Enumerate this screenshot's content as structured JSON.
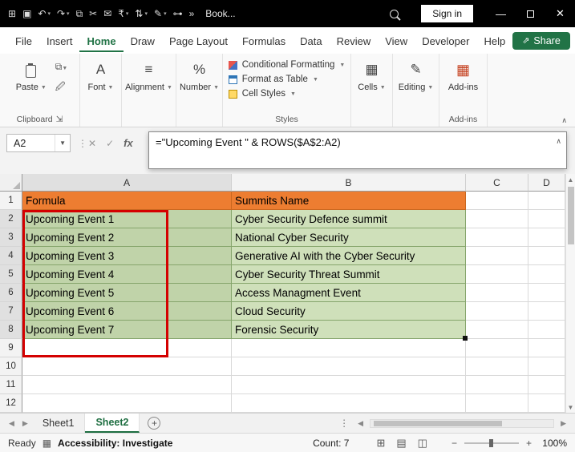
{
  "colors": {
    "excel_green": "#217346",
    "title_bar_bg": "#000000",
    "header_fill_orange": "#ed7d31",
    "cell_fill_green": "#cfe0ba",
    "cell_fill_green_selected": "#c0d3a9",
    "highlight_red": "#d40000",
    "addins_red": "#c43e1c"
  },
  "title_bar": {
    "workbook_name": "Book...",
    "sign_in_label": "Sign in",
    "quick_access": [
      {
        "name": "menu-grid-icon",
        "glyph": "⊞",
        "caret": false
      },
      {
        "name": "save-icon",
        "glyph": "▣",
        "caret": false
      },
      {
        "name": "undo-icon",
        "glyph": "↶",
        "caret": true
      },
      {
        "name": "redo-icon",
        "glyph": "↷",
        "caret": true
      },
      {
        "name": "copy-icon",
        "glyph": "⧉",
        "caret": false
      },
      {
        "name": "cut-icon",
        "glyph": "✂",
        "caret": false
      },
      {
        "name": "mail-icon",
        "glyph": "✉",
        "caret": false
      },
      {
        "name": "currency-icon",
        "glyph": "₹",
        "caret": true
      },
      {
        "name": "sort-icon",
        "glyph": "⇅",
        "caret": true
      },
      {
        "name": "draw-icon",
        "glyph": "✎",
        "caret": true
      },
      {
        "name": "pin-icon",
        "glyph": "⊶",
        "caret": false
      },
      {
        "name": "more-commands-icon",
        "glyph": "»",
        "caret": false
      }
    ]
  },
  "ribbon": {
    "tabs": [
      "File",
      "Insert",
      "Home",
      "Draw",
      "Page Layout",
      "Formulas",
      "Data",
      "Review",
      "View",
      "Developer",
      "Help"
    ],
    "active_tab": "Home",
    "share_label": "Share",
    "paste_label": "Paste",
    "collapsed_groups": [
      {
        "name": "font",
        "label": "Font",
        "icon": "A"
      },
      {
        "name": "alignment",
        "label": "Alignment",
        "icon": "≡"
      },
      {
        "name": "number",
        "label": "Number",
        "icon": "%"
      }
    ],
    "styles_items": [
      "Conditional Formatting",
      "Format as Table",
      "Cell Styles"
    ],
    "styles_group_label": "Styles",
    "clipboard_group_label": "Clipboard",
    "right_groups": [
      {
        "name": "cells",
        "label": "Cells",
        "icon": "▦"
      },
      {
        "name": "editing",
        "label": "Editing",
        "icon": "✎"
      }
    ],
    "addins_label": "Add-ins",
    "addins_group_label": "Add-ins"
  },
  "formula_bar": {
    "name_box": "A2",
    "formula": "=\"Upcoming Event \" & ROWS($A$2:A2)"
  },
  "grid": {
    "column_headers": [
      "A",
      "B",
      "C",
      "D"
    ],
    "row_count": 12,
    "selected_column": "A",
    "selected_rows": [
      2,
      3,
      4,
      5,
      6,
      7,
      8
    ],
    "header_row": {
      "A": "Formula",
      "B": "Summits Name"
    },
    "events": [
      "Upcoming Event 1",
      "Upcoming Event 2",
      "Upcoming Event 3",
      "Upcoming Event 4",
      "Upcoming Event 5",
      "Upcoming Event 6",
      "Upcoming Event 7"
    ],
    "summits": [
      "Cyber Security Defence summit",
      "National Cyber Security",
      "Generative AI with the Cyber Security",
      "Cyber Security  Threat Summit",
      "Access Managment Event",
      "Cloud Security",
      "Forensic Security"
    ]
  },
  "sheet_bar": {
    "sheets": [
      "Sheet1",
      "Sheet2"
    ],
    "active_sheet": "Sheet2"
  },
  "status_bar": {
    "mode": "Ready",
    "accessibility": "Accessibility: Investigate",
    "count": "Count: 7",
    "zoom": "100%"
  }
}
